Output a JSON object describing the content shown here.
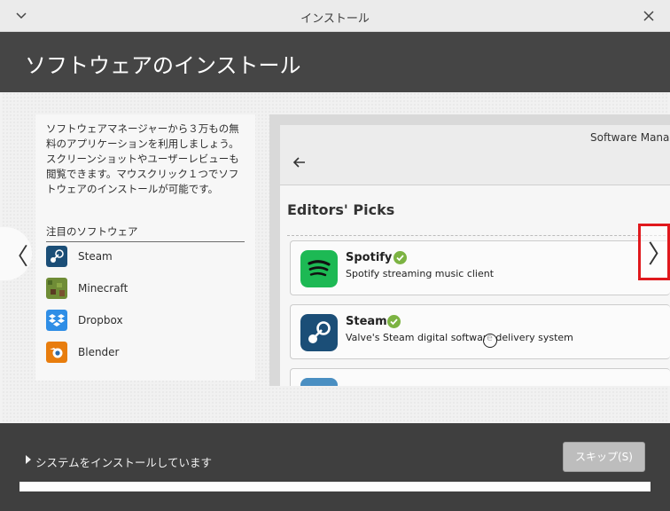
{
  "window": {
    "title": "インストール"
  },
  "header": {
    "title": "ソフトウェアのインストール"
  },
  "left_panel": {
    "description": "ソフトウェアマネージャーから３万もの無料のアプリケーションを利用しましょう。スクリーンショットやユーザーレビューも閲覧できます。マウスクリック１つでソフトウェアのインストールが可能です。",
    "featured_heading": "注目のソフトウェア",
    "items": [
      {
        "label": "Steam",
        "icon": "steam-icon",
        "color": "#1b4e77"
      },
      {
        "label": "Minecraft",
        "icon": "minecraft-icon",
        "color": "#5b7a2e"
      },
      {
        "label": "Dropbox",
        "icon": "dropbox-icon",
        "color": "#2f8ee6"
      },
      {
        "label": "Blender",
        "icon": "blender-icon",
        "color": "#e87d0d"
      }
    ]
  },
  "screenshot": {
    "app_title": "Software Mana",
    "back_icon": "back-arrow-icon",
    "section_title": "Editors' Picks",
    "cards": [
      {
        "name": "Spotify",
        "description": "Spotify streaming music client",
        "icon": "spotify-icon",
        "color": "#1db954"
      },
      {
        "name": "Steam",
        "description": "Valve's Steam digital software delivery system",
        "icon": "steam-icon",
        "color": "#1b4e77"
      }
    ]
  },
  "nav": {
    "prev_glyph": "〈",
    "next_glyph": "〉"
  },
  "bottom": {
    "status_text": "システムをインストールしています",
    "skip_label": "スキップ(S)",
    "progress_fraction": 1.0
  },
  "colors": {
    "accent": "#7cb342",
    "highlight": "#e0191d",
    "header_bg": "#454545"
  }
}
